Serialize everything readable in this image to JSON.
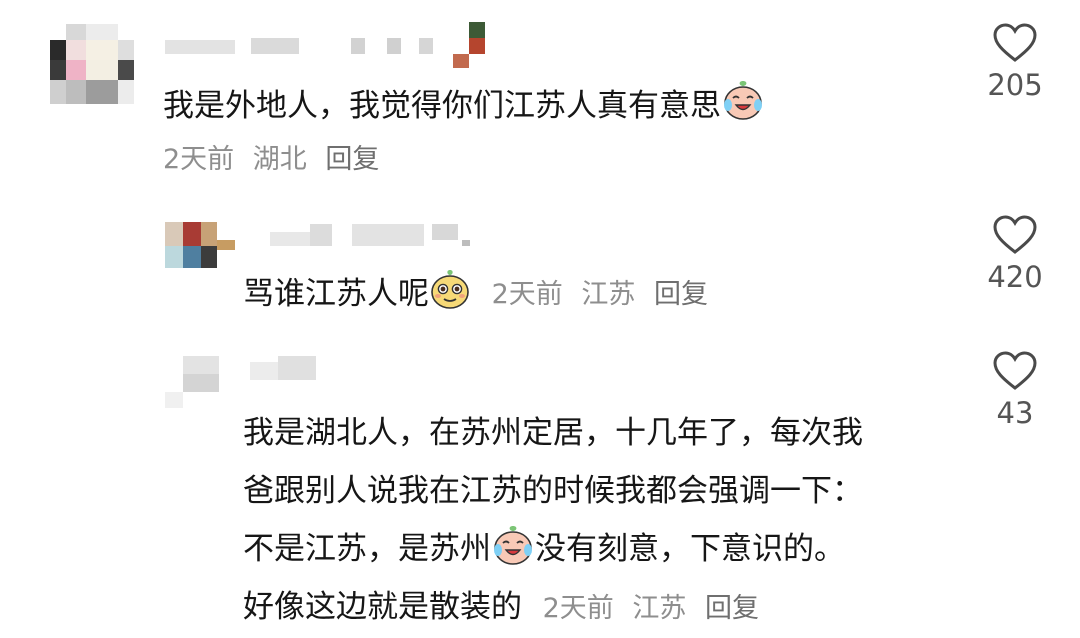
{
  "comments": [
    {
      "text": "我是外地人，我觉得你们江苏人真有意思",
      "emoji": "crying-laughing-face-icon",
      "time": "2天前",
      "location": "湖北",
      "reply_label": "回复",
      "likes": "205"
    },
    {
      "text": "骂谁江苏人呢",
      "emoji": "smug-face-icon",
      "time": "2天前",
      "location": "江苏",
      "reply_label": "回复",
      "likes": "420"
    },
    {
      "text_line1": "我是湖北人，在苏州定居，十几年了，每次我",
      "text_line2": "爸跟别人说我在江苏的时候我都会强调一下：",
      "text_line3a": "不是江苏，是苏州",
      "emoji": "crying-laughing-face-icon",
      "text_line3b": "没有刻意，下意识的。",
      "text_line4": "好像这边就是散装的",
      "time": "2天前",
      "location": "江苏",
      "reply_label": "回复",
      "likes": "43"
    }
  ],
  "colors": {
    "text": "#161616",
    "meta": "#8e8e8e",
    "heart_outline": "#4a4a4a"
  }
}
